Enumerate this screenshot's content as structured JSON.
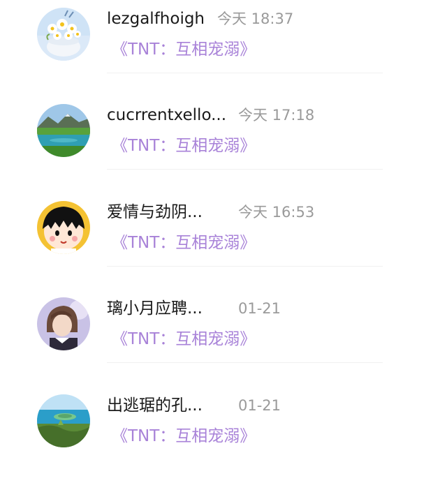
{
  "conversations": [
    {
      "name": "lezgalfhoigh",
      "time": "今天 18:37",
      "preview": "《TNT：互相宠溺》",
      "avatar": "daisy-flowers-avatar"
    },
    {
      "name": "cucrrentxello...",
      "time": "今天 17:18",
      "preview": "《TNT：互相宠溺》",
      "avatar": "mountain-lake-avatar"
    },
    {
      "name": "爱情与劲阴...",
      "time": "今天 16:53",
      "preview": "《TNT：互相宠溺》",
      "avatar": "cartoon-girl-avatar"
    },
    {
      "name": "璃小月应聘...",
      "time": "01-21",
      "preview": "《TNT：互相宠溺》",
      "avatar": "anime-portrait-avatar"
    },
    {
      "name": "出逃琚的孔...",
      "time": "01-21",
      "preview": "《TNT：互相宠溺》",
      "avatar": "island-landscape-avatar"
    }
  ]
}
